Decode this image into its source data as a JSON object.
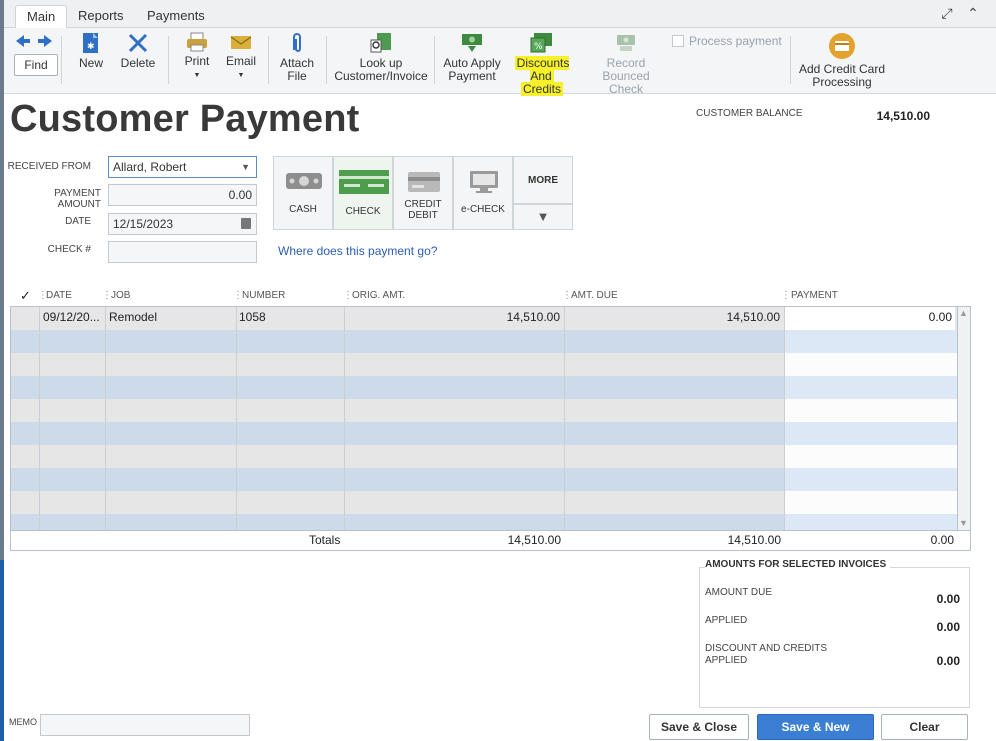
{
  "tabs": [
    "Main",
    "Reports",
    "Payments"
  ],
  "toolbar": {
    "find": "Find",
    "new": "New",
    "delete": "Delete",
    "print": "Print",
    "email": "Email",
    "attach_l1": "Attach",
    "attach_l2": "File",
    "lookup_l1": "Look up",
    "lookup_l2": "Customer/Invoice",
    "autoapply_l1": "Auto Apply",
    "autoapply_l2": "Payment",
    "discounts_l1": "Discounts And",
    "discounts_l2": "Credits",
    "record_l1": "Record",
    "record_l2": "Bounced Check",
    "process_payment": "Process payment",
    "addcc_l1": "Add Credit Card",
    "addcc_l2": "Processing"
  },
  "header": {
    "title": "Customer Payment",
    "customer_balance_label": "CUSTOMER BALANCE",
    "customer_balance": "14,510.00"
  },
  "form": {
    "received_from_label": "RECEIVED FROM",
    "received_from": "Allard, Robert",
    "payment_amount_label": "PAYMENT AMOUNT",
    "payment_amount": "0.00",
    "date_label": "DATE",
    "date": "12/15/2023",
    "check_label": "CHECK #",
    "check": ""
  },
  "payment_methods": {
    "cash": "CASH",
    "check": "CHECK",
    "credit_l1": "CREDIT",
    "credit_l2": "DEBIT",
    "echeck": "e-CHECK",
    "more": "MORE"
  },
  "link": "Where does this payment go?",
  "table": {
    "columns": [
      "✓",
      "DATE",
      "JOB",
      "NUMBER",
      "ORIG. AMT.",
      "AMT. DUE",
      "PAYMENT"
    ],
    "rows": [
      {
        "date": "09/12/20...",
        "job": "Remodel",
        "number": "1058",
        "orig_amt": "14,510.00",
        "amt_due": "14,510.00",
        "payment": "0.00"
      }
    ],
    "totals_label": "Totals",
    "totals_orig": "14,510.00",
    "totals_due": "14,510.00",
    "totals_payment": "0.00"
  },
  "amounts": {
    "title": "AMOUNTS FOR SELECTED INVOICES",
    "amount_due_label": "AMOUNT DUE",
    "amount_due": "0.00",
    "applied_label": "APPLIED",
    "applied": "0.00",
    "discount_l1": "DISCOUNT AND CREDITS",
    "discount_l2": "APPLIED",
    "discount": "0.00"
  },
  "bottom": {
    "memo_label": "MEMO",
    "save_close": "Save & Close",
    "save_new": "Save & New",
    "clear": "Clear"
  },
  "colors": {
    "highlight": "#f6f12a",
    "primary_button": "#3b7fd4",
    "row_blue": "#ccdaea",
    "row_grey": "#e6e6e6",
    "link": "#2a5db0"
  }
}
